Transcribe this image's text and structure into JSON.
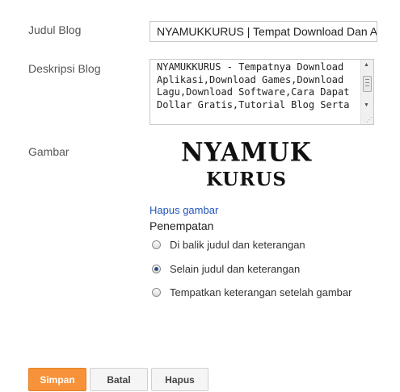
{
  "fields": {
    "title_label": "Judul Blog",
    "title_value": "NYAMUKKURUS | Tempat Download Dan Artikel",
    "desc_label": "Deskripsi Blog",
    "desc_value": "NYAMUKKURUS - Tempatnya Download Aplikasi,Download Games,Download Lagu,Download Software,Cara Dapat Dollar Gratis,Tutorial Blog Serta",
    "image_label": "Gambar"
  },
  "image": {
    "logo_line1": "NYAMUK",
    "logo_line2": "KURUS",
    "remove_link": "Hapus gambar",
    "placement_label": "Penempatan",
    "options": [
      {
        "label": "Di balik judul dan keterangan",
        "checked": false
      },
      {
        "label": "Selain judul dan keterangan",
        "checked": true
      },
      {
        "label": "Tempatkan keterangan setelah gambar",
        "checked": false
      }
    ]
  },
  "buttons": {
    "save": "Simpan",
    "cancel": "Batal",
    "delete": "Hapus"
  }
}
